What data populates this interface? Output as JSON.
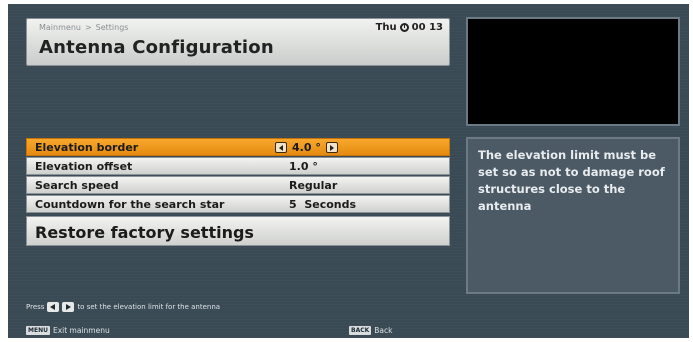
{
  "header": {
    "breadcrumb": [
      "Mainmenu",
      ">",
      "Settings"
    ],
    "title": "Antenna Configuration",
    "day": "Thu",
    "time": "00 13"
  },
  "settings": [
    {
      "label": "Elevation border",
      "value": "4.0 °",
      "selected": true
    },
    {
      "label": "Elevation offset",
      "value": "1.0 °",
      "selected": false
    },
    {
      "label": "Search speed",
      "value": "Regular",
      "selected": false
    },
    {
      "label": "Countdown for the search star",
      "value": "5  Seconds",
      "selected": false
    }
  ],
  "restore_label": "Restore factory settings",
  "info_text": "The elevation limit must be set so as not to damage roof structures close to the antenna",
  "hint": {
    "prefix": "Press",
    "suffix": "to set the elevation limit for the antenna"
  },
  "footer": {
    "menu_key": "MENU",
    "menu_label": "Exit mainmenu",
    "back_key": "BACK",
    "back_label": "Back"
  },
  "colors": {
    "selected": "#f39c1f",
    "background": "#394a55"
  }
}
